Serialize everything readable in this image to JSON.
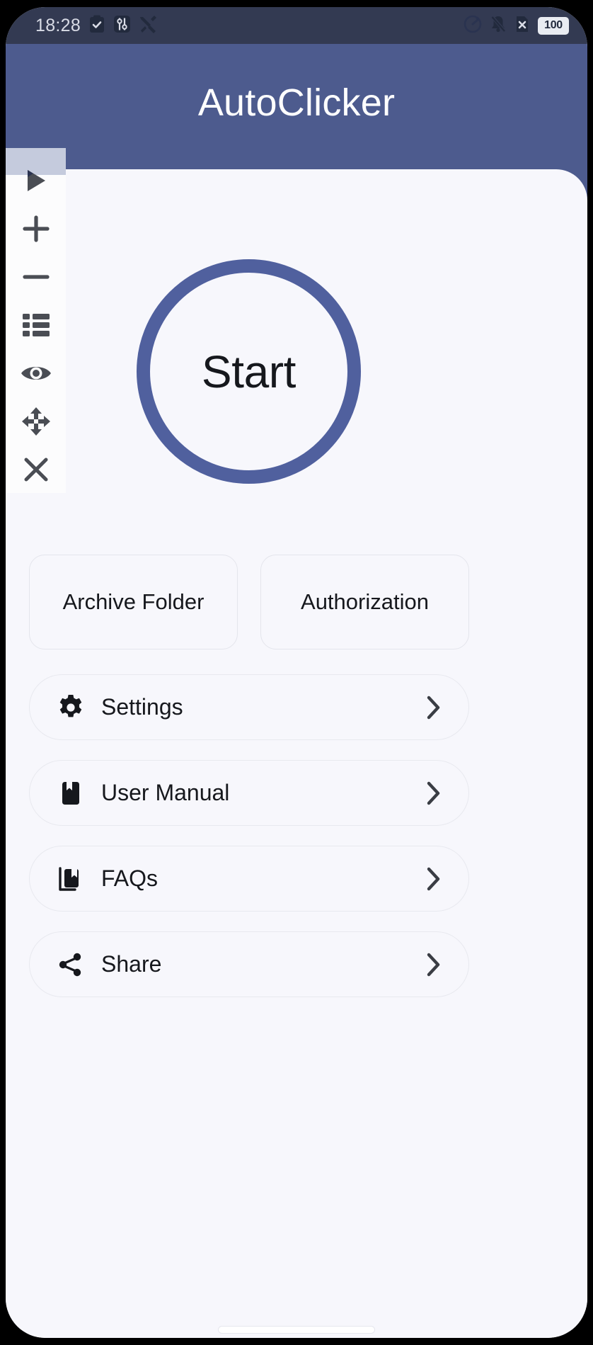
{
  "status_bar": {
    "time": "18:28",
    "battery_level": "100",
    "left_icons": [
      "clipboard-check-icon",
      "sliders-settings-icon",
      "tools-icon"
    ],
    "right_icons": [
      "gauge-speed-icon",
      "bell-muted-icon",
      "sim-card-off-icon"
    ]
  },
  "header": {
    "title": "AutoClicker",
    "background_color": "#4d5b8e"
  },
  "floating_toolbar": {
    "buttons": [
      {
        "name": "play",
        "icon": "play-icon"
      },
      {
        "name": "add",
        "icon": "plus-icon"
      },
      {
        "name": "remove",
        "icon": "minus-icon"
      },
      {
        "name": "list",
        "icon": "list-icon"
      },
      {
        "name": "preview",
        "icon": "eye-icon"
      },
      {
        "name": "move",
        "icon": "move-arrows-icon"
      },
      {
        "name": "close",
        "icon": "close-x-icon"
      }
    ]
  },
  "start_button": {
    "label": "Start",
    "ring_color": "#50609e"
  },
  "pill_buttons": [
    {
      "label": "Archive Folder"
    },
    {
      "label": "Authorization"
    }
  ],
  "nav_list": [
    {
      "label": "Settings",
      "icon": "gear-icon",
      "chevron": "chevron-right-icon"
    },
    {
      "label": "User Manual",
      "icon": "book-icon",
      "chevron": "chevron-right-icon"
    },
    {
      "label": "FAQs",
      "icon": "books-icon",
      "chevron": "chevron-right-icon"
    },
    {
      "label": "Share",
      "icon": "share-icon",
      "chevron": "chevron-right-icon"
    }
  ]
}
